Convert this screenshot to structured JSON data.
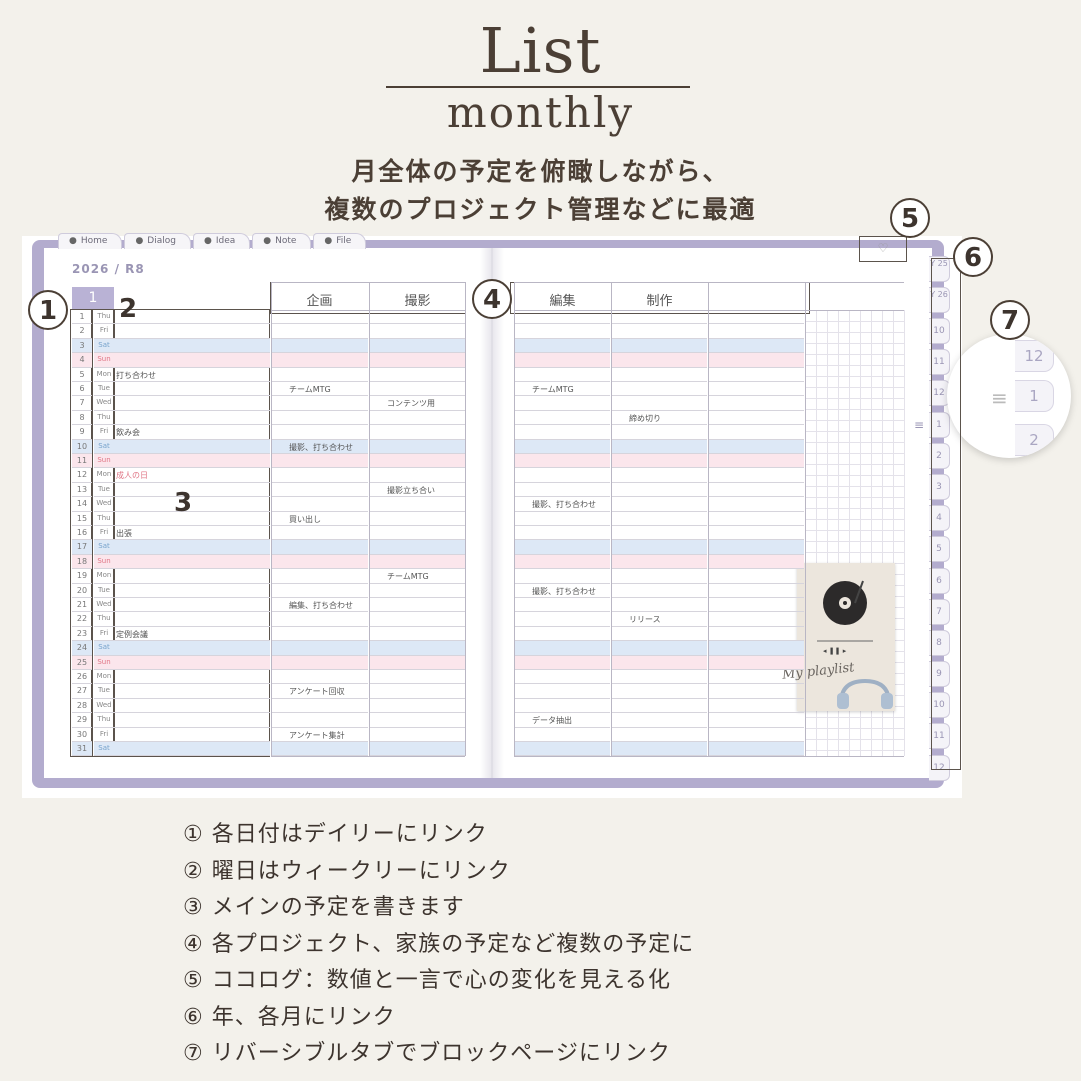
{
  "header": {
    "title": "List",
    "subtitle": "monthly",
    "tagline_line1": "月全体の予定を俯瞰しながら、",
    "tagline_line2": "複数のプロジェクト管理などに最適"
  },
  "planner": {
    "nav_tabs": [
      {
        "label": "Home",
        "icon": "home-icon"
      },
      {
        "label": "Dialog",
        "icon": "dialog-icon"
      },
      {
        "label": "Idea",
        "icon": "lightbulb-icon"
      },
      {
        "label": "Note",
        "icon": "note-icon"
      },
      {
        "label": "File",
        "icon": "folder-icon"
      }
    ],
    "year_label": "2026 / R8",
    "month_number": "1",
    "project_headers_left": [
      "企画",
      "撮影"
    ],
    "project_headers_right": [
      "編集",
      "制作"
    ],
    "days": [
      {
        "d": "1",
        "w": "Thu"
      },
      {
        "d": "2",
        "w": "Fri"
      },
      {
        "d": "3",
        "w": "Sat"
      },
      {
        "d": "4",
        "w": "Sun"
      },
      {
        "d": "5",
        "w": "Mon"
      },
      {
        "d": "6",
        "w": "Tue"
      },
      {
        "d": "7",
        "w": "Wed"
      },
      {
        "d": "8",
        "w": "Thu"
      },
      {
        "d": "9",
        "w": "Fri"
      },
      {
        "d": "10",
        "w": "Sat"
      },
      {
        "d": "11",
        "w": "Sun"
      },
      {
        "d": "12",
        "w": "Mon"
      },
      {
        "d": "13",
        "w": "Tue"
      },
      {
        "d": "14",
        "w": "Wed"
      },
      {
        "d": "15",
        "w": "Thu"
      },
      {
        "d": "16",
        "w": "Fri"
      },
      {
        "d": "17",
        "w": "Sat"
      },
      {
        "d": "18",
        "w": "Sun"
      },
      {
        "d": "19",
        "w": "Mon"
      },
      {
        "d": "20",
        "w": "Tue"
      },
      {
        "d": "21",
        "w": "Wed"
      },
      {
        "d": "22",
        "w": "Thu"
      },
      {
        "d": "23",
        "w": "Fri"
      },
      {
        "d": "24",
        "w": "Sat"
      },
      {
        "d": "25",
        "w": "Sun"
      },
      {
        "d": "26",
        "w": "Mon"
      },
      {
        "d": "27",
        "w": "Tue"
      },
      {
        "d": "28",
        "w": "Wed"
      },
      {
        "d": "29",
        "w": "Thu"
      },
      {
        "d": "30",
        "w": "Fri"
      },
      {
        "d": "31",
        "w": "Sat"
      }
    ],
    "main_notes": {
      "5": "打ち合わせ",
      "9": "飲み会",
      "12": "成人の日",
      "16": "出張",
      "23": "定例会議"
    },
    "project_notes": [
      {
        "row": 6,
        "col": 0,
        "text": "チームMTG"
      },
      {
        "row": 7,
        "col": 1,
        "text": "コンテンツ用"
      },
      {
        "row": 10,
        "col": 0,
        "text": "撮影、打ち合わせ"
      },
      {
        "row": 13,
        "col": 1,
        "text": "撮影立ち合い"
      },
      {
        "row": 15,
        "col": 0,
        "text": "買い出し"
      },
      {
        "row": 19,
        "col": 1,
        "text": "チームMTG"
      },
      {
        "row": 21,
        "col": 0,
        "text": "編集、打ち合わせ"
      },
      {
        "row": 27,
        "col": 0,
        "text": "アンケート回収"
      },
      {
        "row": 30,
        "col": 0,
        "text": "アンケート集計"
      },
      {
        "row": 6,
        "col": 2,
        "text": "チームMTG"
      },
      {
        "row": 8,
        "col": 3,
        "text": "締め切り"
      },
      {
        "row": 14,
        "col": 2,
        "text": "撮影、打ち合わせ"
      },
      {
        "row": 20,
        "col": 2,
        "text": "撮影、打ち合わせ"
      },
      {
        "row": 22,
        "col": 3,
        "text": "リリース"
      },
      {
        "row": 29,
        "col": 2,
        "text": "データ抽出"
      }
    ],
    "year_tabs": [
      "Y 25",
      "Y 26"
    ],
    "month_tabs": [
      "10",
      "11",
      "12",
      "1",
      "2",
      "3",
      "4",
      "5",
      "6",
      "7",
      "8",
      "9",
      "10",
      "11",
      "12"
    ],
    "zoom_tabs": [
      "12",
      "1",
      "2"
    ],
    "playlist_text": "My playlist",
    "markers": [
      "1",
      "2",
      "3",
      "4",
      "5",
      "6",
      "7"
    ]
  },
  "legend": [
    "① 各日付はデイリーにリンク",
    "② 曜日はウィークリーにリンク",
    "③ メインの予定を書きます",
    "④ 各プロジェクト、家族の予定など複数の予定に",
    "⑤ ココログ：数値と一言で心の変化を見える化",
    "⑥ 年、各月にリンク",
    "⑦ リバーシブルタブでブロックページにリンク"
  ],
  "colors": {
    "accent": "#b3acce",
    "saturday": "#dde8f6",
    "sunday": "#fbe6ec",
    "text": "#4b3f35"
  }
}
